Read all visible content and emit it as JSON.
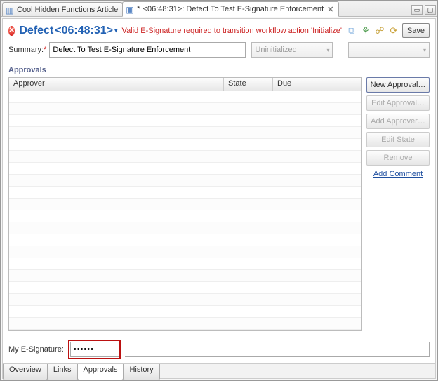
{
  "tabs": {
    "tab0": {
      "label": "Cool Hidden Functions Article"
    },
    "tab1": {
      "dirty": "*",
      "label": "<06:48:31>: Defect To Test E-Signature Enforcement"
    }
  },
  "header": {
    "title_prefix": "Defect ",
    "title_id": "<06:48:31>",
    "wf_message": "Valid E-Signature required to transition workflow action 'Initialize'"
  },
  "toolbar": {
    "save": "Save"
  },
  "summary": {
    "label": "Summary:",
    "value": "Defect To Test E-Signature Enforcement",
    "state_value": "Uninitialized",
    "combo2_value": ""
  },
  "approvals": {
    "title": "Approvals",
    "columns": {
      "approver": "Approver",
      "state": "State",
      "due": "Due"
    },
    "rows": [],
    "buttons": {
      "new": "New Approval…",
      "edit": "Edit Approval…",
      "add": "Add Approver…",
      "editstate": "Edit State",
      "remove": "Remove",
      "comment": "Add Comment"
    }
  },
  "esig": {
    "label": "My E-Signature:",
    "value": "••••••"
  },
  "bottom_tabs": {
    "overview": "Overview",
    "links": "Links",
    "approvals": "Approvals",
    "history": "History"
  }
}
